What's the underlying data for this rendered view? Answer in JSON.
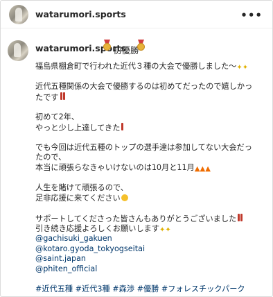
{
  "header": {
    "username": "watarumori.sports",
    "more": "•••"
  },
  "caption": {
    "username": "watarumori.sports",
    "title": "初優勝",
    "lines": [
      "福島県棚倉町で行われた近代３種の大会で優勝しました〜",
      "",
      "近代五種関係の大会で優勝するのは初めてだったので嬉しかっ",
      "たです",
      "",
      "初めて2年、",
      "やっと少し上達してきた",
      "",
      "でも今回は近代五種のトップの選手達は参加してない大会だっ",
      "たので、",
      "本当に頑張らなきゃいけないのは10月と11月",
      "",
      "人生を賭けて頑張るので、",
      "足非応援に来てください",
      "",
      "サポートしてくださった皆さんもありがとうございました",
      "引き続き応援よろしくお願いします"
    ],
    "mentions": [
      "@gachisuki_gakuen",
      "@kotaro.gyoda_tokyogseitai",
      "@saint.japan",
      "@phiten_official"
    ],
    "hashtags": "#近代五種 #近代3種 #森渉 #優勝 #フォレスチックパーク"
  },
  "icons": [
    "medal-icon",
    "sparkle-icon",
    "double-exclamation-icon",
    "fire-icon",
    "grinning-face-icon",
    "more-icon"
  ]
}
